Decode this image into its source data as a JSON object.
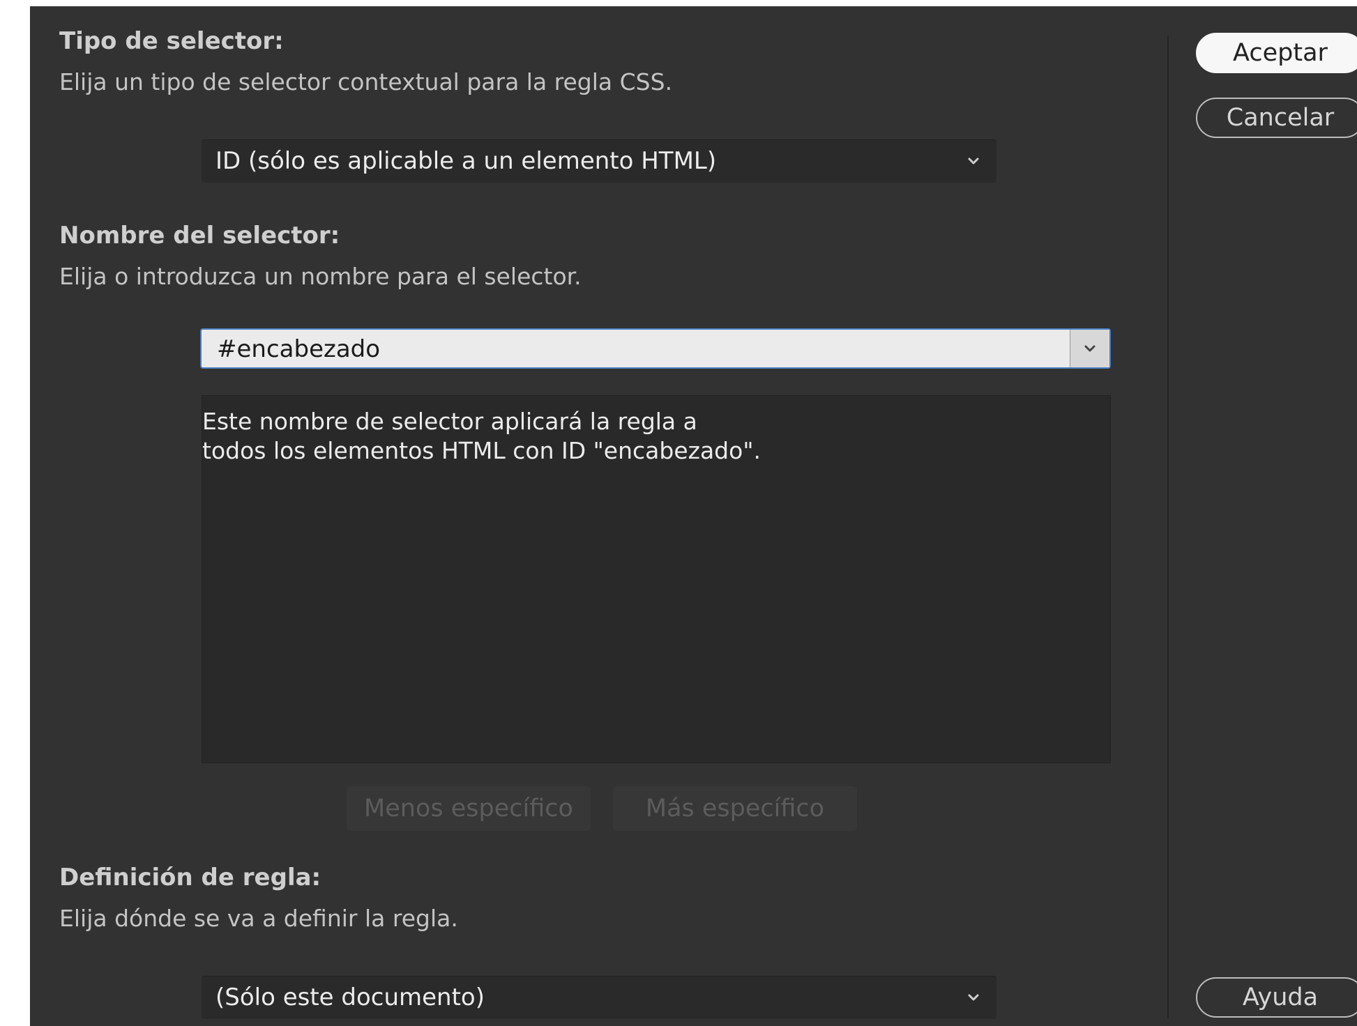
{
  "selector_type": {
    "heading": "Tipo de selector:",
    "description": "Elija un tipo de selector contextual para la regla CSS.",
    "selected": "ID (sólo es aplicable a un elemento HTML)"
  },
  "selector_name": {
    "heading": "Nombre del selector:",
    "description": "Elija o introduzca un nombre para el selector.",
    "value": "#encabezado",
    "info_lines": [
      "Este nombre de selector aplicará la regla a",
      "todos los elementos HTML con ID \"encabezado\"."
    ],
    "less_specific_label": "Menos específico",
    "more_specific_label": "Más específico"
  },
  "rule_definition": {
    "heading": "Definición de regla:",
    "description": "Elija dónde se va a definir la regla.",
    "selected": "(Sólo este documento)"
  },
  "buttons": {
    "accept": "Aceptar",
    "cancel": "Cancelar",
    "help": "Ayuda"
  },
  "colors": {
    "dialog_bg": "#323232",
    "focus_border": "#4b7fc1"
  },
  "icons": {
    "dropdown": "chevron-down-icon"
  }
}
